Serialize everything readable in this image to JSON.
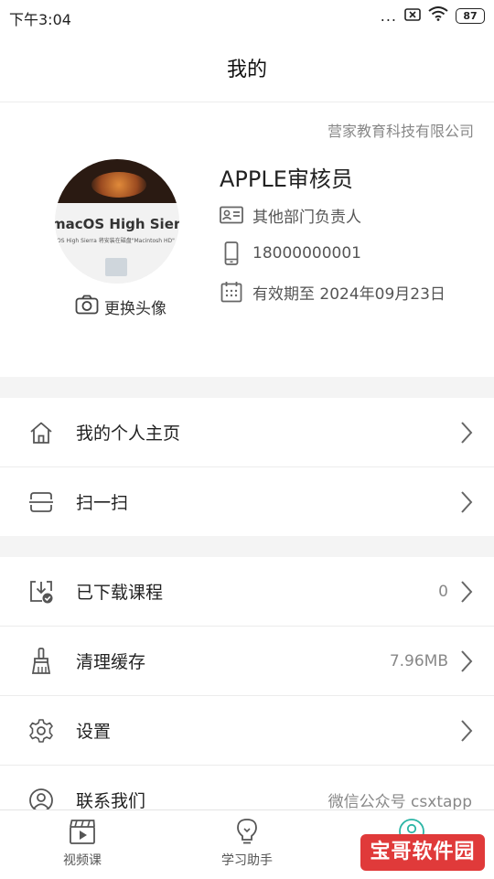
{
  "status": {
    "time": "下午3:04",
    "battery": "87",
    "dots": "..."
  },
  "nav": {
    "title": "我的"
  },
  "profile": {
    "company": "营家教育科技有限公司",
    "avatar_text": "macOS High Sierra",
    "avatar_small_text": "OS High Sierra 将安装在磁盘\"Macintosh HD\"",
    "change_avatar": "更换头像",
    "name": "APPLE审核员",
    "role": "其他部门负责人",
    "phone": "18000000001",
    "valid_until": "有效期至 2024年09月23日"
  },
  "menu_group_1": [
    {
      "label": "我的个人主页",
      "icon": "home-icon"
    },
    {
      "label": "扫一扫",
      "icon": "scan-icon"
    }
  ],
  "menu_group_2": [
    {
      "label": "已下载课程",
      "icon": "download-icon",
      "value": "0"
    },
    {
      "label": "清理缓存",
      "icon": "brush-icon",
      "value": "7.96MB"
    },
    {
      "label": "设置",
      "icon": "gear-icon"
    },
    {
      "label": "联系我们",
      "icon": "contact-icon",
      "value": "微信公众号 csxtapp"
    }
  ],
  "tabs": [
    {
      "label": "视频课",
      "icon": "video-clapper-icon"
    },
    {
      "label": "学习助手",
      "icon": "lightbulb-icon"
    },
    {
      "label": "我的",
      "icon": "user-icon",
      "active": true
    }
  ],
  "watermark": "宝哥软件园",
  "colors": {
    "accent": "#2bb5a5",
    "watermark": "#e03a3a"
  }
}
